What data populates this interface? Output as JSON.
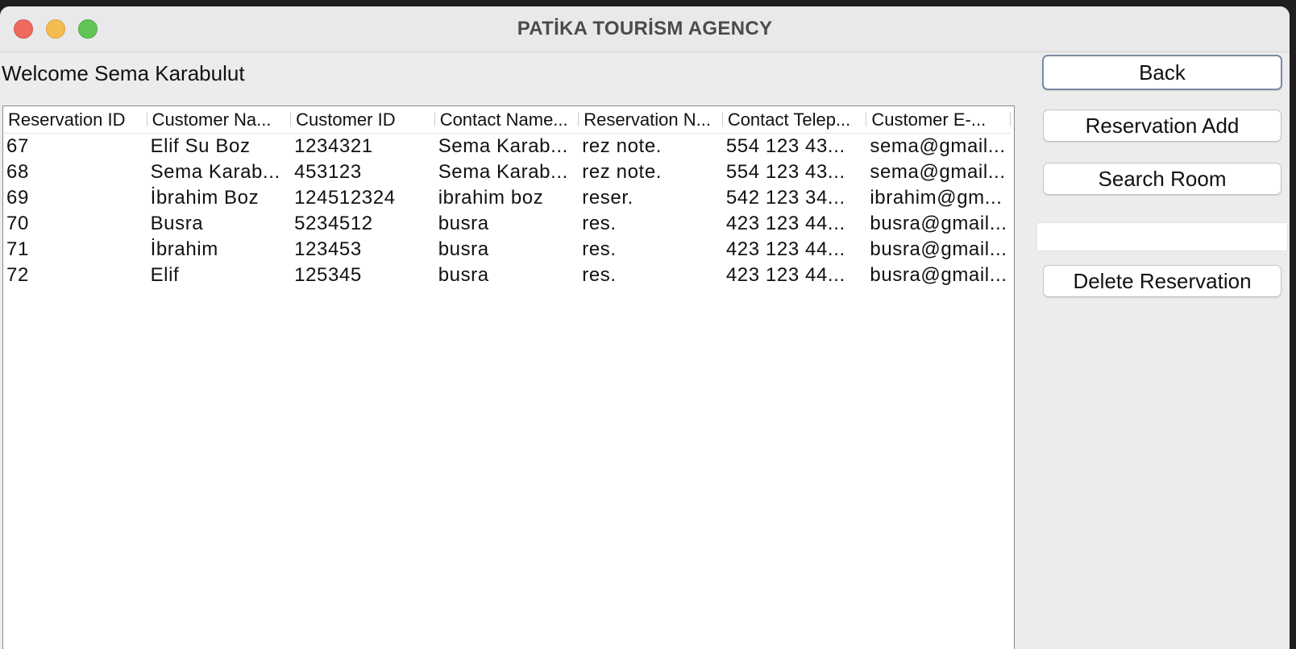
{
  "window": {
    "title": "PATİKA TOURİSM AGENCY"
  },
  "welcome": "Welcome Sema Karabulut",
  "table": {
    "columns": [
      "Reservation ID",
      "Customer Na...",
      "Customer ID",
      "Contact Name...",
      "Reservation N...",
      "Contact Telep...",
      "Customer E-..."
    ],
    "rows": [
      [
        "67",
        "Elif Su Boz",
        "1234321",
        "Sema Karab...",
        "rez note.",
        "554 123 43...",
        "sema@gmail..."
      ],
      [
        "68",
        "Sema Karab...",
        "453123",
        "Sema Karab...",
        "rez note.",
        "554 123 43...",
        "sema@gmail..."
      ],
      [
        "69",
        "İbrahim Boz",
        "124512324",
        "ibrahim boz",
        "reser.",
        "542 123 34...",
        "ibrahim@gm..."
      ],
      [
        "70",
        "Busra",
        "5234512",
        "busra",
        "res.",
        "423 123 44...",
        "busra@gmail..."
      ],
      [
        "71",
        "İbrahim",
        "123453",
        "busra",
        "res.",
        "423 123 44...",
        "busra@gmail..."
      ],
      [
        "72",
        "Elif",
        "125345",
        "busra",
        "res.",
        "423 123 44...",
        "busra@gmail..."
      ]
    ]
  },
  "sidebar": {
    "back_label": "Back",
    "reservation_add_label": "Reservation Add",
    "search_room_label": "Search Room",
    "search_value": "",
    "delete_label": "Delete Reservation"
  }
}
